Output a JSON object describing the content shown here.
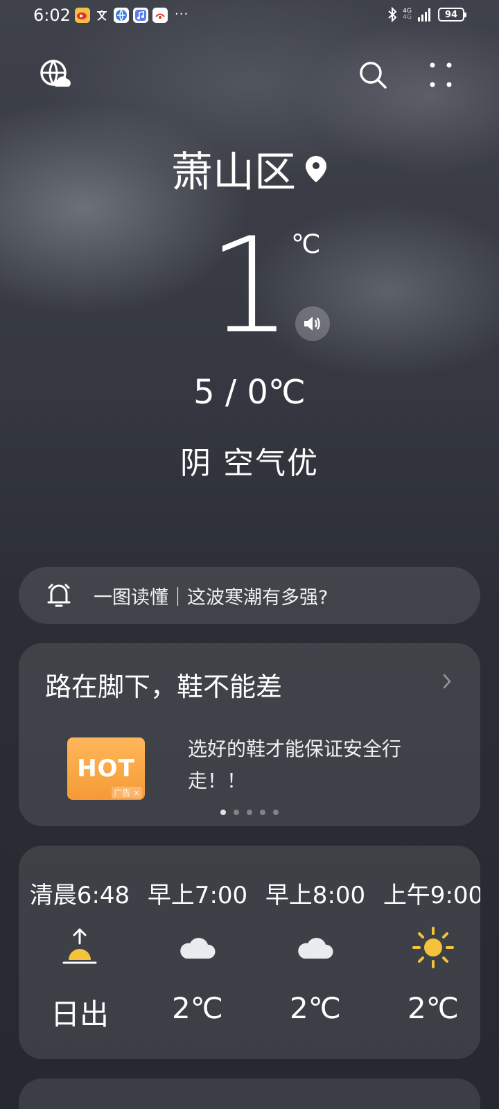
{
  "status_bar": {
    "time": "6:02",
    "more": "···",
    "network_top": "4G",
    "network_bottom": "4G",
    "battery": "94",
    "apps": [
      "weibo-icon",
      "translate-icon",
      "browser-icon",
      "music-icon",
      "sina-icon"
    ]
  },
  "hero": {
    "city": "萧山区",
    "temperature": "1",
    "unit": "℃",
    "range": "5 / 0℃",
    "condition": "阴 空气优"
  },
  "alert": {
    "text": "一图读懂｜这波寒潮有多强?"
  },
  "ad": {
    "title": "路在脚下，鞋不能差",
    "badge": "HOT",
    "tag": "广告 ×",
    "desc": "选好的鞋才能保证安全行走！！",
    "dots": 5,
    "active_dot": 0
  },
  "hourly": [
    {
      "time": "清晨6:48",
      "icon": "sunrise-icon",
      "value": "日出"
    },
    {
      "time": "早上7:00",
      "icon": "cloud-icon",
      "value": "2℃"
    },
    {
      "time": "早上8:00",
      "icon": "cloud-icon",
      "value": "2℃"
    },
    {
      "time": "上午9:00",
      "icon": "sun-icon",
      "value": "2℃"
    }
  ],
  "colors": {
    "sun": "#f5c33b",
    "hot_badge": "#f59a36"
  }
}
